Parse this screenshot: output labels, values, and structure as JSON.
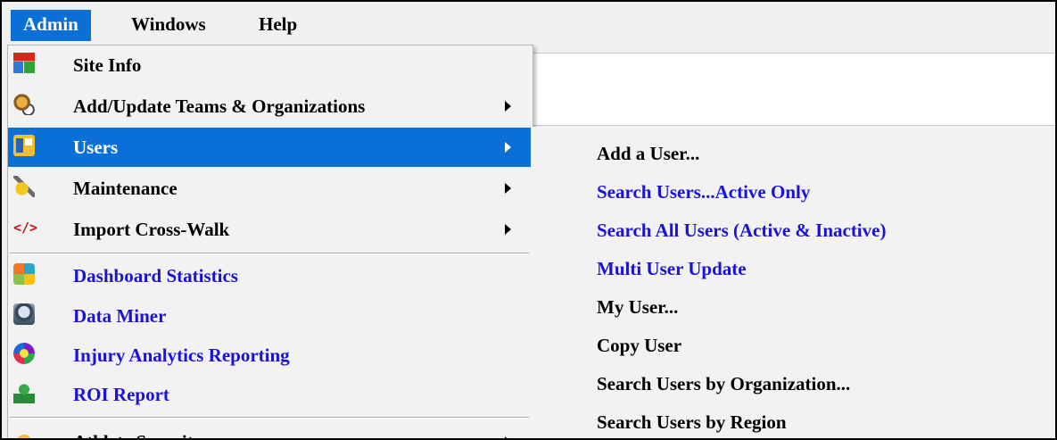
{
  "menubar": {
    "items": [
      "Admin",
      "Windows",
      "Help"
    ]
  },
  "admin_menu": {
    "items": [
      {
        "label": "Site Info",
        "icon": "site-info-icon",
        "submenu": false,
        "link": false
      },
      {
        "label": "Add/Update Teams & Organizations",
        "icon": "teams-icon",
        "submenu": true,
        "link": false
      },
      {
        "label": "Users",
        "icon": "users-icon",
        "submenu": true,
        "link": false,
        "selected": true
      },
      {
        "label": "Maintenance",
        "icon": "maintenance-icon",
        "submenu": true,
        "link": false
      },
      {
        "label": "Import Cross-Walk",
        "icon": "code-icon",
        "submenu": true,
        "link": false
      },
      {
        "label": "Dashboard Statistics",
        "icon": "dashboard-icon",
        "submenu": false,
        "link": true
      },
      {
        "label": "Data Miner",
        "icon": "data-miner-icon",
        "submenu": false,
        "link": true
      },
      {
        "label": "Injury Analytics Reporting",
        "icon": "injury-analytics-icon",
        "submenu": false,
        "link": true
      },
      {
        "label": "ROI Report",
        "icon": "roi-report-icon",
        "submenu": false,
        "link": true
      },
      {
        "label": "Athlete Security",
        "icon": "athlete-security-icon",
        "submenu": true,
        "link": false
      }
    ]
  },
  "users_submenu": {
    "items": [
      {
        "label": "Add a User...",
        "link": false
      },
      {
        "label": "Search Users...Active Only",
        "link": true
      },
      {
        "label": "Search All Users (Active & Inactive)",
        "link": true
      },
      {
        "label": "Multi User Update",
        "link": true
      },
      {
        "label": "My User...",
        "link": false
      },
      {
        "label": "Copy User",
        "link": false
      },
      {
        "label": "Search Users by Organization...",
        "link": false
      },
      {
        "label": "Search Users by Region",
        "link": false
      }
    ]
  },
  "colors": {
    "selection": "#0a6fd6",
    "link": "#1a12d6",
    "menu_bg": "#f2f2f2"
  }
}
